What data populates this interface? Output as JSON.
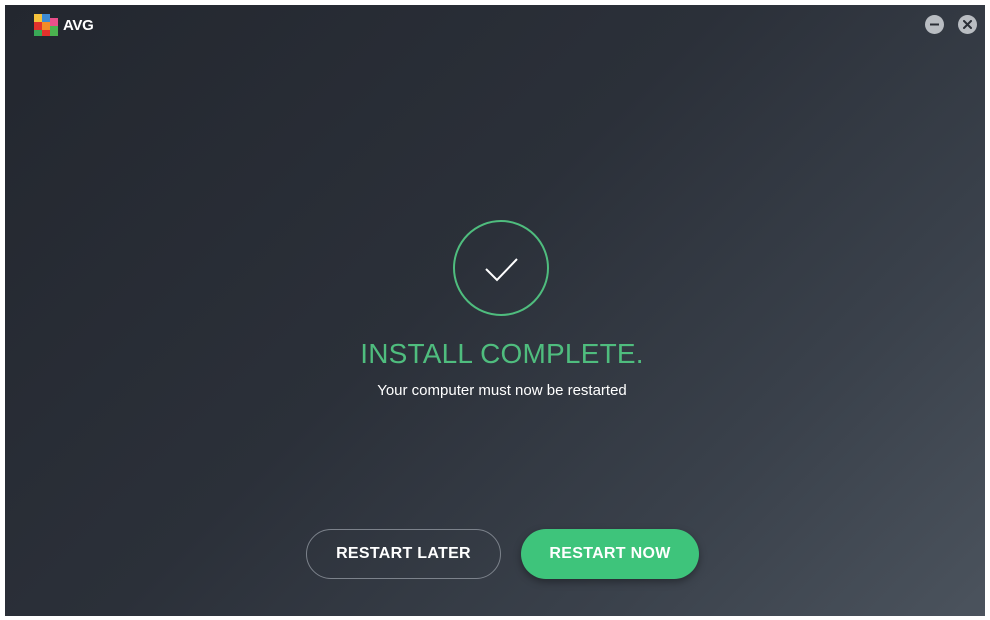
{
  "app": {
    "name": "AVG",
    "logo_icon": "avg-logo-icon"
  },
  "window_controls": {
    "minimize_icon": "minimize-icon",
    "close_icon": "close-icon"
  },
  "status": {
    "icon": "checkmark-icon",
    "title": "INSTALL COMPLETE.",
    "subtitle": "Your computer must now be restarted"
  },
  "actions": {
    "restart_later_label": "RESTART LATER",
    "restart_now_label": "RESTART NOW"
  },
  "colors": {
    "accent": "#4fbd7e",
    "button_primary": "#3ec47b",
    "background_dark": "#23272f",
    "background_light": "#4b535d"
  }
}
